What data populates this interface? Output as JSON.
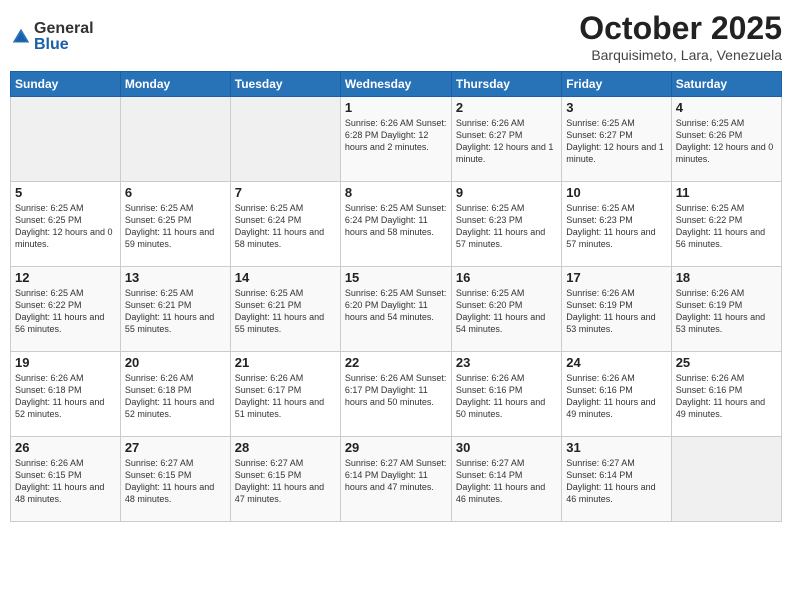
{
  "header": {
    "logo_general": "General",
    "logo_blue": "Blue",
    "month_title": "October 2025",
    "location": "Barquisimeto, Lara, Venezuela"
  },
  "days_of_week": [
    "Sunday",
    "Monday",
    "Tuesday",
    "Wednesday",
    "Thursday",
    "Friday",
    "Saturday"
  ],
  "weeks": [
    [
      {
        "day": "",
        "info": ""
      },
      {
        "day": "",
        "info": ""
      },
      {
        "day": "",
        "info": ""
      },
      {
        "day": "1",
        "info": "Sunrise: 6:26 AM\nSunset: 6:28 PM\nDaylight: 12 hours\nand 2 minutes."
      },
      {
        "day": "2",
        "info": "Sunrise: 6:26 AM\nSunset: 6:27 PM\nDaylight: 12 hours\nand 1 minute."
      },
      {
        "day": "3",
        "info": "Sunrise: 6:25 AM\nSunset: 6:27 PM\nDaylight: 12 hours\nand 1 minute."
      },
      {
        "day": "4",
        "info": "Sunrise: 6:25 AM\nSunset: 6:26 PM\nDaylight: 12 hours\nand 0 minutes."
      }
    ],
    [
      {
        "day": "5",
        "info": "Sunrise: 6:25 AM\nSunset: 6:25 PM\nDaylight: 12 hours\nand 0 minutes."
      },
      {
        "day": "6",
        "info": "Sunrise: 6:25 AM\nSunset: 6:25 PM\nDaylight: 11 hours\nand 59 minutes."
      },
      {
        "day": "7",
        "info": "Sunrise: 6:25 AM\nSunset: 6:24 PM\nDaylight: 11 hours\nand 58 minutes."
      },
      {
        "day": "8",
        "info": "Sunrise: 6:25 AM\nSunset: 6:24 PM\nDaylight: 11 hours\nand 58 minutes."
      },
      {
        "day": "9",
        "info": "Sunrise: 6:25 AM\nSunset: 6:23 PM\nDaylight: 11 hours\nand 57 minutes."
      },
      {
        "day": "10",
        "info": "Sunrise: 6:25 AM\nSunset: 6:23 PM\nDaylight: 11 hours\nand 57 minutes."
      },
      {
        "day": "11",
        "info": "Sunrise: 6:25 AM\nSunset: 6:22 PM\nDaylight: 11 hours\nand 56 minutes."
      }
    ],
    [
      {
        "day": "12",
        "info": "Sunrise: 6:25 AM\nSunset: 6:22 PM\nDaylight: 11 hours\nand 56 minutes."
      },
      {
        "day": "13",
        "info": "Sunrise: 6:25 AM\nSunset: 6:21 PM\nDaylight: 11 hours\nand 55 minutes."
      },
      {
        "day": "14",
        "info": "Sunrise: 6:25 AM\nSunset: 6:21 PM\nDaylight: 11 hours\nand 55 minutes."
      },
      {
        "day": "15",
        "info": "Sunrise: 6:25 AM\nSunset: 6:20 PM\nDaylight: 11 hours\nand 54 minutes."
      },
      {
        "day": "16",
        "info": "Sunrise: 6:25 AM\nSunset: 6:20 PM\nDaylight: 11 hours\nand 54 minutes."
      },
      {
        "day": "17",
        "info": "Sunrise: 6:26 AM\nSunset: 6:19 PM\nDaylight: 11 hours\nand 53 minutes."
      },
      {
        "day": "18",
        "info": "Sunrise: 6:26 AM\nSunset: 6:19 PM\nDaylight: 11 hours\nand 53 minutes."
      }
    ],
    [
      {
        "day": "19",
        "info": "Sunrise: 6:26 AM\nSunset: 6:18 PM\nDaylight: 11 hours\nand 52 minutes."
      },
      {
        "day": "20",
        "info": "Sunrise: 6:26 AM\nSunset: 6:18 PM\nDaylight: 11 hours\nand 52 minutes."
      },
      {
        "day": "21",
        "info": "Sunrise: 6:26 AM\nSunset: 6:17 PM\nDaylight: 11 hours\nand 51 minutes."
      },
      {
        "day": "22",
        "info": "Sunrise: 6:26 AM\nSunset: 6:17 PM\nDaylight: 11 hours\nand 50 minutes."
      },
      {
        "day": "23",
        "info": "Sunrise: 6:26 AM\nSunset: 6:16 PM\nDaylight: 11 hours\nand 50 minutes."
      },
      {
        "day": "24",
        "info": "Sunrise: 6:26 AM\nSunset: 6:16 PM\nDaylight: 11 hours\nand 49 minutes."
      },
      {
        "day": "25",
        "info": "Sunrise: 6:26 AM\nSunset: 6:16 PM\nDaylight: 11 hours\nand 49 minutes."
      }
    ],
    [
      {
        "day": "26",
        "info": "Sunrise: 6:26 AM\nSunset: 6:15 PM\nDaylight: 11 hours\nand 48 minutes."
      },
      {
        "day": "27",
        "info": "Sunrise: 6:27 AM\nSunset: 6:15 PM\nDaylight: 11 hours\nand 48 minutes."
      },
      {
        "day": "28",
        "info": "Sunrise: 6:27 AM\nSunset: 6:15 PM\nDaylight: 11 hours\nand 47 minutes."
      },
      {
        "day": "29",
        "info": "Sunrise: 6:27 AM\nSunset: 6:14 PM\nDaylight: 11 hours\nand 47 minutes."
      },
      {
        "day": "30",
        "info": "Sunrise: 6:27 AM\nSunset: 6:14 PM\nDaylight: 11 hours\nand 46 minutes."
      },
      {
        "day": "31",
        "info": "Sunrise: 6:27 AM\nSunset: 6:14 PM\nDaylight: 11 hours\nand 46 minutes."
      },
      {
        "day": "",
        "info": ""
      }
    ]
  ]
}
